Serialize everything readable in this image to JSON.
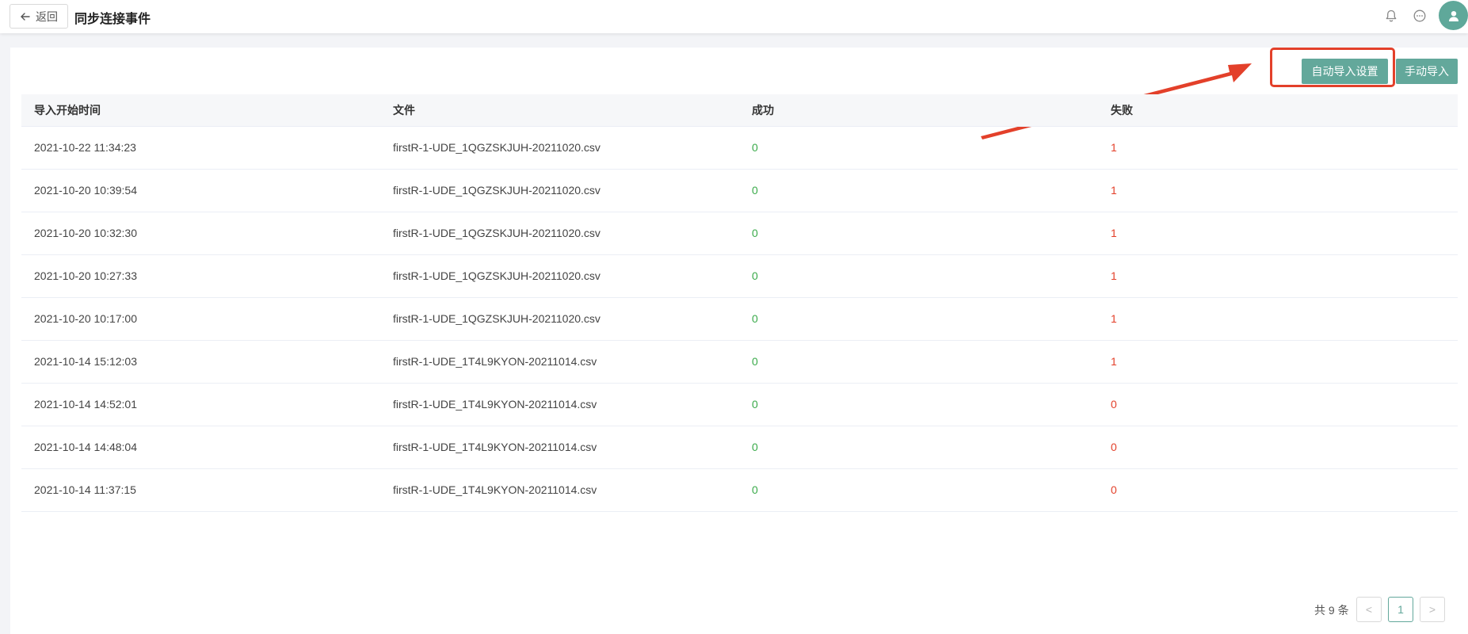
{
  "header": {
    "back_label": "返回",
    "title": "同步连接事件"
  },
  "toolbar": {
    "auto_import_label": "自动导入设置",
    "manual_import_label": "手动导入"
  },
  "table": {
    "columns": [
      "导入开始时间",
      "文件",
      "成功",
      "失败"
    ],
    "rows": [
      {
        "time": "2021-10-22 11:34:23",
        "file": "firstR-1-UDE_1QGZSKJUH-20211020.csv",
        "success": "0",
        "fail": "1"
      },
      {
        "time": "2021-10-20 10:39:54",
        "file": "firstR-1-UDE_1QGZSKJUH-20211020.csv",
        "success": "0",
        "fail": "1"
      },
      {
        "time": "2021-10-20 10:32:30",
        "file": "firstR-1-UDE_1QGZSKJUH-20211020.csv",
        "success": "0",
        "fail": "1"
      },
      {
        "time": "2021-10-20 10:27:33",
        "file": "firstR-1-UDE_1QGZSKJUH-20211020.csv",
        "success": "0",
        "fail": "1"
      },
      {
        "time": "2021-10-20 10:17:00",
        "file": "firstR-1-UDE_1QGZSKJUH-20211020.csv",
        "success": "0",
        "fail": "1"
      },
      {
        "time": "2021-10-14 15:12:03",
        "file": "firstR-1-UDE_1T4L9KYON-20211014.csv",
        "success": "0",
        "fail": "1"
      },
      {
        "time": "2021-10-14 14:52:01",
        "file": "firstR-1-UDE_1T4L9KYON-20211014.csv",
        "success": "0",
        "fail": "0"
      },
      {
        "time": "2021-10-14 14:48:04",
        "file": "firstR-1-UDE_1T4L9KYON-20211014.csv",
        "success": "0",
        "fail": "0"
      },
      {
        "time": "2021-10-14 11:37:15",
        "file": "firstR-1-UDE_1T4L9KYON-20211014.csv",
        "success": "0",
        "fail": "0"
      }
    ]
  },
  "pagination": {
    "total_label": "共 9 条",
    "prev": "<",
    "current": "1",
    "next": ">"
  },
  "colors": {
    "accent": "#63a89b",
    "success": "#3aaa4a",
    "fail": "#e3402a",
    "annotation": "#e3402a"
  },
  "icons": [
    "arrow-left-icon",
    "bell-icon",
    "chat-icon",
    "user-icon"
  ]
}
